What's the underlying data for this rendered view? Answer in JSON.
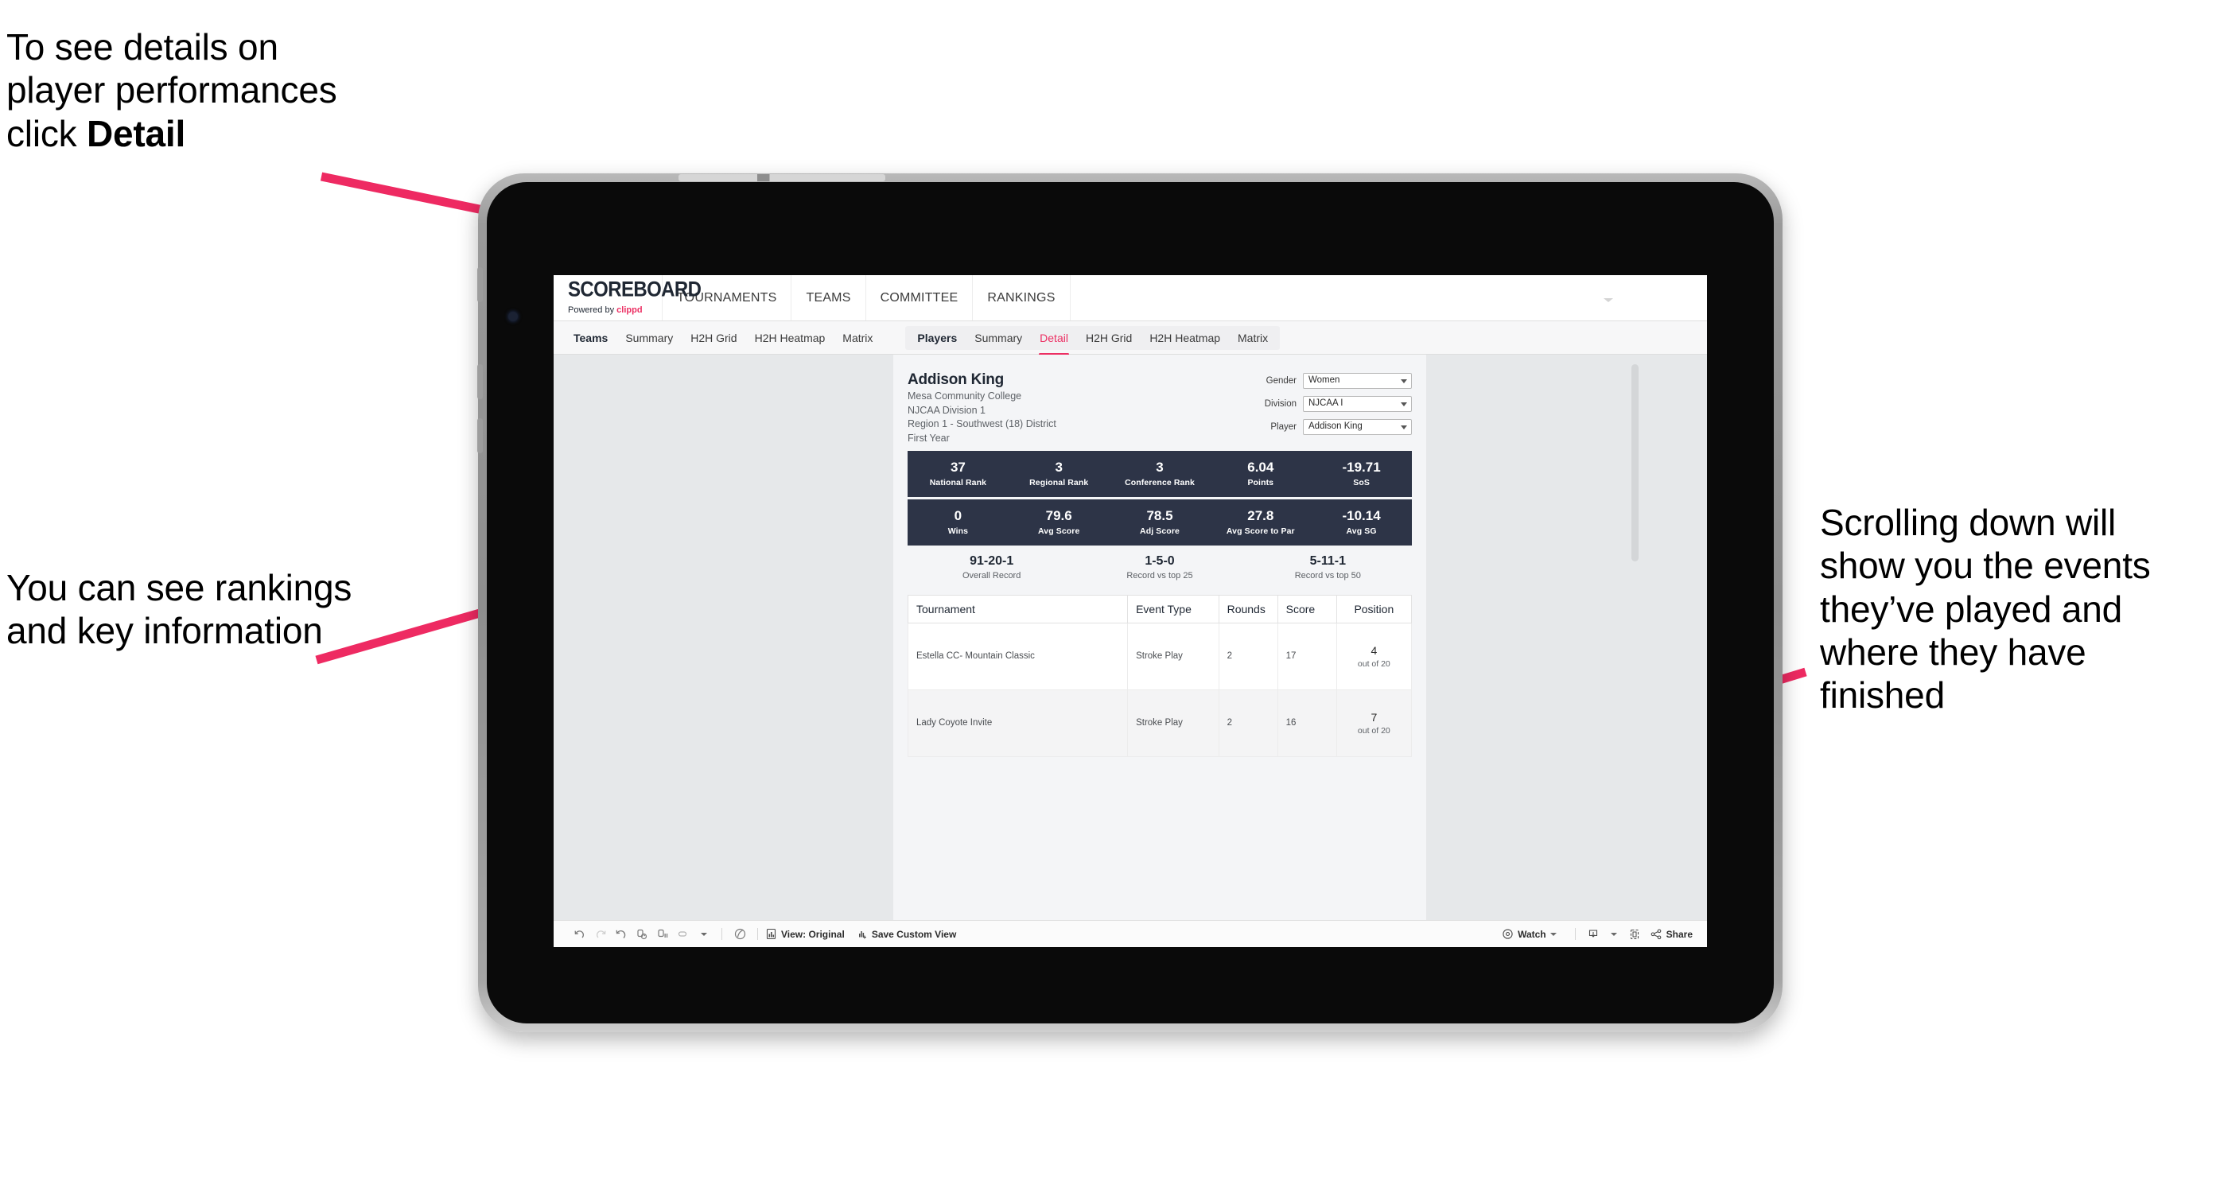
{
  "annotations": {
    "detail_note_line1": "To see details on",
    "detail_note_line2": "player performances",
    "detail_note_line3_prefix": "click ",
    "detail_note_line3_bold": "Detail",
    "rankings_note": "You can see rankings and key information",
    "scroll_note": "Scrolling down will show you the events they’ve played and where they have finished"
  },
  "topnav": {
    "logo_word": "SCOREBOARD",
    "logo_sub_prefix": "Powered by ",
    "logo_sub_brand": "clippd",
    "items": [
      "TOURNAMENTS",
      "TEAMS",
      "COMMITTEE",
      "RANKINGS"
    ]
  },
  "subnav": {
    "teams_group_label": "Teams",
    "teams_items": [
      "Summary",
      "H2H Grid",
      "H2H Heatmap",
      "Matrix"
    ],
    "players_group_label": "Players",
    "players_items": [
      "Summary",
      "Detail",
      "H2H Grid",
      "H2H Heatmap",
      "Matrix"
    ],
    "active_item": "Detail"
  },
  "player": {
    "name": "Addison King",
    "school": "Mesa Community College",
    "division": "NJCAA Division 1",
    "region": "Region 1 - Southwest (18) District",
    "year": "First Year"
  },
  "filters": [
    {
      "label": "Gender",
      "value": "Women"
    },
    {
      "label": "Division",
      "value": "NJCAA I"
    },
    {
      "label": "Player",
      "value": "Addison King"
    }
  ],
  "stats_row_1": [
    {
      "value": "37",
      "label": "National Rank"
    },
    {
      "value": "3",
      "label": "Regional Rank"
    },
    {
      "value": "3",
      "label": "Conference Rank"
    },
    {
      "value": "6.04",
      "label": "Points"
    },
    {
      "value": "-19.71",
      "label": "SoS"
    }
  ],
  "stats_row_2": [
    {
      "value": "0",
      "label": "Wins"
    },
    {
      "value": "79.6",
      "label": "Avg Score"
    },
    {
      "value": "78.5",
      "label": "Adj Score"
    },
    {
      "value": "27.8",
      "label": "Avg Score to Par"
    },
    {
      "value": "-10.14",
      "label": "Avg SG"
    }
  ],
  "records": [
    {
      "value": "91-20-1",
      "label": "Overall Record"
    },
    {
      "value": "1-5-0",
      "label": "Record vs top 25"
    },
    {
      "value": "5-11-1",
      "label": "Record vs top 50"
    }
  ],
  "events_table": {
    "columns": [
      "Tournament",
      "Event Type",
      "Rounds",
      "Score",
      "Position"
    ],
    "rows": [
      {
        "tournament": "Estella CC- Mountain Classic",
        "event_type": "Stroke Play",
        "rounds": "2",
        "score": "17",
        "position": "4",
        "position_of": "out of 20"
      },
      {
        "tournament": "Lady Coyote Invite",
        "event_type": "Stroke Play",
        "rounds": "2",
        "score": "16",
        "position": "7",
        "position_of": "out of 20"
      }
    ]
  },
  "toolbar": {
    "view_label": "View: Original",
    "save_label": "Save Custom View",
    "watch_label": "Watch",
    "share_label": "Share"
  },
  "colors": {
    "accent_pink": "#ec2f63",
    "stat_bar_navy": "#2d3447",
    "page_bg": "#e6e8ea",
    "annotation_arrow": "#ee2a62"
  }
}
